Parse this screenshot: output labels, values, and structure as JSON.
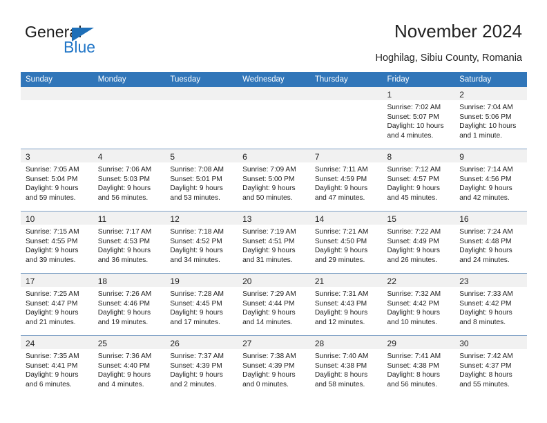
{
  "brand": {
    "word_one": "General",
    "word_two": "Blue",
    "triangle_color": "#1e6fb8",
    "blue_text_color": "#2176c7"
  },
  "header": {
    "title": "November 2024",
    "location": "Hoghilag, Sibiu County, Romania"
  },
  "theme": {
    "header_blue": "#3176b9",
    "daynum_band": "#f1f1f1",
    "row_rule": "#7d9fc4"
  },
  "calendar": {
    "weekday_headers": [
      "Sunday",
      "Monday",
      "Tuesday",
      "Wednesday",
      "Thursday",
      "Friday",
      "Saturday"
    ],
    "weeks": [
      [
        {
          "day": "",
          "sunrise": "",
          "sunset": "",
          "daylight_1": "",
          "daylight_2": ""
        },
        {
          "day": "",
          "sunrise": "",
          "sunset": "",
          "daylight_1": "",
          "daylight_2": ""
        },
        {
          "day": "",
          "sunrise": "",
          "sunset": "",
          "daylight_1": "",
          "daylight_2": ""
        },
        {
          "day": "",
          "sunrise": "",
          "sunset": "",
          "daylight_1": "",
          "daylight_2": ""
        },
        {
          "day": "",
          "sunrise": "",
          "sunset": "",
          "daylight_1": "",
          "daylight_2": ""
        },
        {
          "day": "1",
          "sunrise": "Sunrise: 7:02 AM",
          "sunset": "Sunset: 5:07 PM",
          "daylight_1": "Daylight: 10 hours",
          "daylight_2": "and 4 minutes."
        },
        {
          "day": "2",
          "sunrise": "Sunrise: 7:04 AM",
          "sunset": "Sunset: 5:06 PM",
          "daylight_1": "Daylight: 10 hours",
          "daylight_2": "and 1 minute."
        }
      ],
      [
        {
          "day": "3",
          "sunrise": "Sunrise: 7:05 AM",
          "sunset": "Sunset: 5:04 PM",
          "daylight_1": "Daylight: 9 hours",
          "daylight_2": "and 59 minutes."
        },
        {
          "day": "4",
          "sunrise": "Sunrise: 7:06 AM",
          "sunset": "Sunset: 5:03 PM",
          "daylight_1": "Daylight: 9 hours",
          "daylight_2": "and 56 minutes."
        },
        {
          "day": "5",
          "sunrise": "Sunrise: 7:08 AM",
          "sunset": "Sunset: 5:01 PM",
          "daylight_1": "Daylight: 9 hours",
          "daylight_2": "and 53 minutes."
        },
        {
          "day": "6",
          "sunrise": "Sunrise: 7:09 AM",
          "sunset": "Sunset: 5:00 PM",
          "daylight_1": "Daylight: 9 hours",
          "daylight_2": "and 50 minutes."
        },
        {
          "day": "7",
          "sunrise": "Sunrise: 7:11 AM",
          "sunset": "Sunset: 4:59 PM",
          "daylight_1": "Daylight: 9 hours",
          "daylight_2": "and 47 minutes."
        },
        {
          "day": "8",
          "sunrise": "Sunrise: 7:12 AM",
          "sunset": "Sunset: 4:57 PM",
          "daylight_1": "Daylight: 9 hours",
          "daylight_2": "and 45 minutes."
        },
        {
          "day": "9",
          "sunrise": "Sunrise: 7:14 AM",
          "sunset": "Sunset: 4:56 PM",
          "daylight_1": "Daylight: 9 hours",
          "daylight_2": "and 42 minutes."
        }
      ],
      [
        {
          "day": "10",
          "sunrise": "Sunrise: 7:15 AM",
          "sunset": "Sunset: 4:55 PM",
          "daylight_1": "Daylight: 9 hours",
          "daylight_2": "and 39 minutes."
        },
        {
          "day": "11",
          "sunrise": "Sunrise: 7:17 AM",
          "sunset": "Sunset: 4:53 PM",
          "daylight_1": "Daylight: 9 hours",
          "daylight_2": "and 36 minutes."
        },
        {
          "day": "12",
          "sunrise": "Sunrise: 7:18 AM",
          "sunset": "Sunset: 4:52 PM",
          "daylight_1": "Daylight: 9 hours",
          "daylight_2": "and 34 minutes."
        },
        {
          "day": "13",
          "sunrise": "Sunrise: 7:19 AM",
          "sunset": "Sunset: 4:51 PM",
          "daylight_1": "Daylight: 9 hours",
          "daylight_2": "and 31 minutes."
        },
        {
          "day": "14",
          "sunrise": "Sunrise: 7:21 AM",
          "sunset": "Sunset: 4:50 PM",
          "daylight_1": "Daylight: 9 hours",
          "daylight_2": "and 29 minutes."
        },
        {
          "day": "15",
          "sunrise": "Sunrise: 7:22 AM",
          "sunset": "Sunset: 4:49 PM",
          "daylight_1": "Daylight: 9 hours",
          "daylight_2": "and 26 minutes."
        },
        {
          "day": "16",
          "sunrise": "Sunrise: 7:24 AM",
          "sunset": "Sunset: 4:48 PM",
          "daylight_1": "Daylight: 9 hours",
          "daylight_2": "and 24 minutes."
        }
      ],
      [
        {
          "day": "17",
          "sunrise": "Sunrise: 7:25 AM",
          "sunset": "Sunset: 4:47 PM",
          "daylight_1": "Daylight: 9 hours",
          "daylight_2": "and 21 minutes."
        },
        {
          "day": "18",
          "sunrise": "Sunrise: 7:26 AM",
          "sunset": "Sunset: 4:46 PM",
          "daylight_1": "Daylight: 9 hours",
          "daylight_2": "and 19 minutes."
        },
        {
          "day": "19",
          "sunrise": "Sunrise: 7:28 AM",
          "sunset": "Sunset: 4:45 PM",
          "daylight_1": "Daylight: 9 hours",
          "daylight_2": "and 17 minutes."
        },
        {
          "day": "20",
          "sunrise": "Sunrise: 7:29 AM",
          "sunset": "Sunset: 4:44 PM",
          "daylight_1": "Daylight: 9 hours",
          "daylight_2": "and 14 minutes."
        },
        {
          "day": "21",
          "sunrise": "Sunrise: 7:31 AM",
          "sunset": "Sunset: 4:43 PM",
          "daylight_1": "Daylight: 9 hours",
          "daylight_2": "and 12 minutes."
        },
        {
          "day": "22",
          "sunrise": "Sunrise: 7:32 AM",
          "sunset": "Sunset: 4:42 PM",
          "daylight_1": "Daylight: 9 hours",
          "daylight_2": "and 10 minutes."
        },
        {
          "day": "23",
          "sunrise": "Sunrise: 7:33 AM",
          "sunset": "Sunset: 4:42 PM",
          "daylight_1": "Daylight: 9 hours",
          "daylight_2": "and 8 minutes."
        }
      ],
      [
        {
          "day": "24",
          "sunrise": "Sunrise: 7:35 AM",
          "sunset": "Sunset: 4:41 PM",
          "daylight_1": "Daylight: 9 hours",
          "daylight_2": "and 6 minutes."
        },
        {
          "day": "25",
          "sunrise": "Sunrise: 7:36 AM",
          "sunset": "Sunset: 4:40 PM",
          "daylight_1": "Daylight: 9 hours",
          "daylight_2": "and 4 minutes."
        },
        {
          "day": "26",
          "sunrise": "Sunrise: 7:37 AM",
          "sunset": "Sunset: 4:39 PM",
          "daylight_1": "Daylight: 9 hours",
          "daylight_2": "and 2 minutes."
        },
        {
          "day": "27",
          "sunrise": "Sunrise: 7:38 AM",
          "sunset": "Sunset: 4:39 PM",
          "daylight_1": "Daylight: 9 hours",
          "daylight_2": "and 0 minutes."
        },
        {
          "day": "28",
          "sunrise": "Sunrise: 7:40 AM",
          "sunset": "Sunset: 4:38 PM",
          "daylight_1": "Daylight: 8 hours",
          "daylight_2": "and 58 minutes."
        },
        {
          "day": "29",
          "sunrise": "Sunrise: 7:41 AM",
          "sunset": "Sunset: 4:38 PM",
          "daylight_1": "Daylight: 8 hours",
          "daylight_2": "and 56 minutes."
        },
        {
          "day": "30",
          "sunrise": "Sunrise: 7:42 AM",
          "sunset": "Sunset: 4:37 PM",
          "daylight_1": "Daylight: 8 hours",
          "daylight_2": "and 55 minutes."
        }
      ]
    ]
  }
}
